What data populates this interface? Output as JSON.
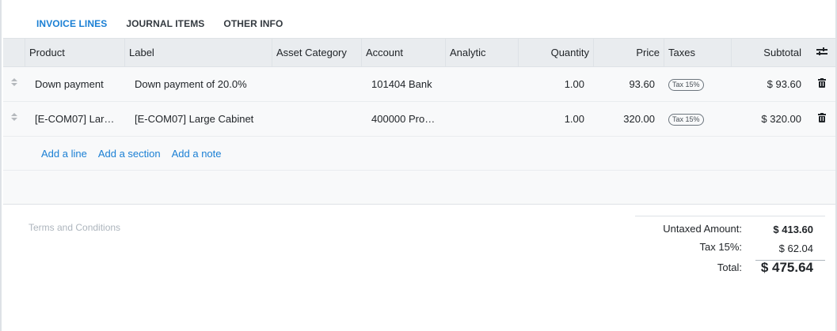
{
  "tabs": [
    {
      "label": "INVOICE LINES",
      "active": true
    },
    {
      "label": "JOURNAL ITEMS",
      "active": false
    },
    {
      "label": "OTHER INFO",
      "active": false
    }
  ],
  "table": {
    "headers": {
      "product": "Product",
      "label": "Label",
      "asset_category": "Asset Category",
      "account": "Account",
      "analytic": "Analytic",
      "quantity": "Quantity",
      "price": "Price",
      "taxes": "Taxes",
      "subtotal": "Subtotal"
    },
    "rows": [
      {
        "product": "Down payment",
        "label": "Down payment of 20.0%",
        "asset_category": "",
        "account": "101404 Bank",
        "analytic": "",
        "quantity": "1.00",
        "price": "93.60",
        "tax": "Tax 15%",
        "subtotal": "$ 93.60"
      },
      {
        "product": "[E-COM07] Lar…",
        "label": "[E-COM07] Large Cabinet",
        "asset_category": "",
        "account": "400000 Pro…",
        "analytic": "",
        "quantity": "1.00",
        "price": "320.00",
        "tax": "Tax 15%",
        "subtotal": "$ 320.00"
      }
    ],
    "add_links": {
      "add_line": "Add a line",
      "add_section": "Add a section",
      "add_note": "Add a note"
    }
  },
  "footer": {
    "terms_placeholder": "Terms and Conditions",
    "untaxed_label": "Untaxed Amount:",
    "untaxed_value": "$ 413.60",
    "tax_label": "Tax 15%:",
    "tax_value": "$ 62.04",
    "total_label": "Total:",
    "total_value": "$ 475.64"
  },
  "colors": {
    "accent": "#1a7fd4",
    "header_bg": "#e9ecef",
    "row_bg": "#f8f9fa"
  }
}
